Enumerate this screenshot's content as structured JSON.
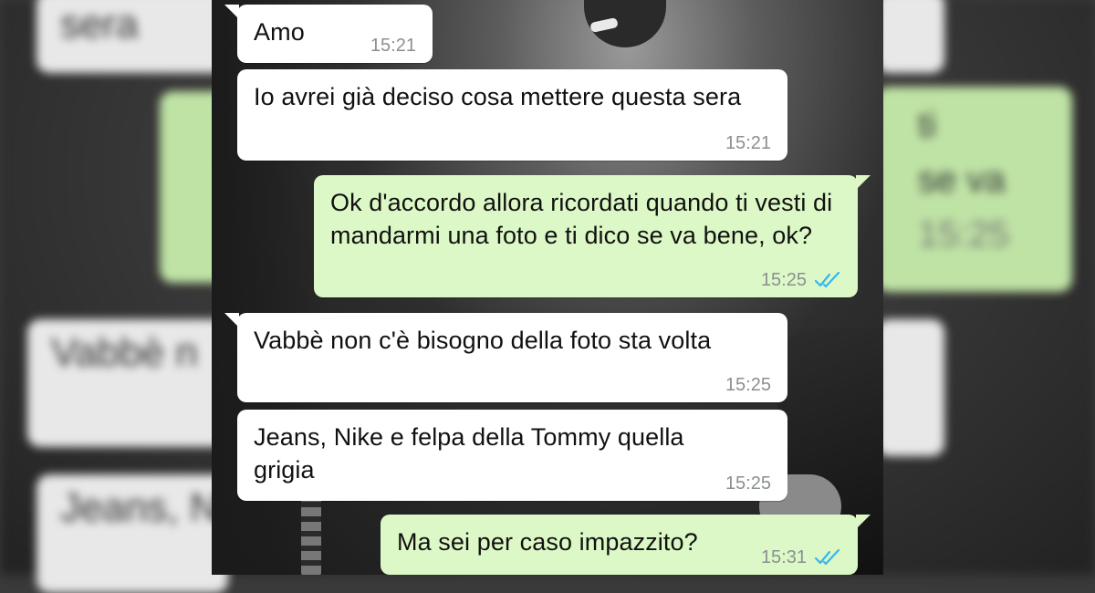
{
  "chat": {
    "messages": [
      {
        "direction": "incoming",
        "text": "Amo",
        "time": "15:21"
      },
      {
        "direction": "incoming",
        "text": "Io avrei già deciso cosa mettere questa sera",
        "time": "15:21"
      },
      {
        "direction": "outgoing",
        "text": "Ok d'accordo allora ricordati quando ti vesti di mandarmi una foto e ti dico se va bene, ok?",
        "time": "15:25",
        "status_icon": "double-check-read-icon"
      },
      {
        "direction": "incoming",
        "text": "Vabbè non c'è bisogno della foto sta volta",
        "time": "15:25"
      },
      {
        "direction": "incoming",
        "text": "Jeans, Nike e felpa della Tommy quella grigia",
        "time": "15:25"
      },
      {
        "direction": "outgoing",
        "text": "Ma sei per caso impazzito?",
        "time": "15:31",
        "status_icon": "double-check-read-icon"
      }
    ]
  },
  "background_fragments": {
    "left": [
      "sera",
      "Vabbè n",
      "Jeans, N"
    ],
    "right": [
      "ti",
      "se va",
      "15:25"
    ]
  },
  "colors": {
    "incoming_bubble": "#ffffff",
    "outgoing_bubble": "#dcf8c6",
    "timestamp": "#8a8f93",
    "read_ticks": "#34b7f1"
  }
}
